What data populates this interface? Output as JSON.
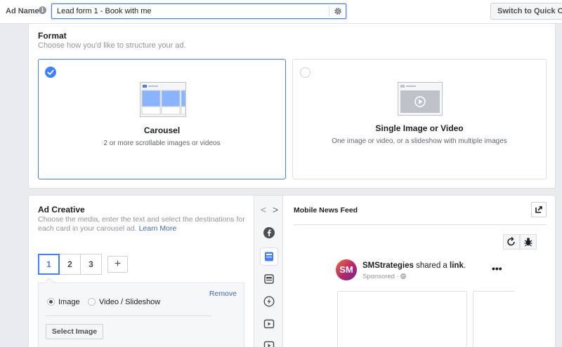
{
  "top_bar": {
    "ad_name_label": "Ad Name",
    "ad_name_value": "Lead form 1 - Book with me",
    "switch_button_label": "Switch to Quick Cre"
  },
  "format": {
    "title": "Format",
    "subtitle": "Choose how you'd like to structure your ad.",
    "options": [
      {
        "title": "Carousel",
        "description": "2 or more scrollable images or videos",
        "selected": true
      },
      {
        "title": "Single Image or Video",
        "description": "One image or video, or a slideshow with multiple images",
        "selected": false
      }
    ]
  },
  "ad_creative": {
    "title": "Ad Creative",
    "description": "Choose the media, enter the text and select the destinations for each card in your carousel ad.",
    "learn_more": "Learn More",
    "card_tabs": [
      "1",
      "2",
      "3"
    ],
    "add_card_label": "+",
    "active_card": "1",
    "remove_label": "Remove",
    "media_options": [
      {
        "label": "Image",
        "selected": true
      },
      {
        "label": "Video / Slideshow",
        "selected": false
      }
    ],
    "select_image_label": "Select Image"
  },
  "placement_rail": {
    "nav_prev": "<",
    "nav_next": ">",
    "icons": [
      "facebook-icon",
      "news-feed-icon",
      "marketplace-icon",
      "instant-articles-icon",
      "video-feed-icon",
      "stories-icon"
    ],
    "active": "news-feed-icon"
  },
  "preview": {
    "title": "Mobile News Feed",
    "page_name": "SMStrategies",
    "shared_text": "shared a",
    "link_text": "link",
    "sponsored": "Sponsored",
    "avatar_text": "SM"
  },
  "colors": {
    "accent": "#4080ff",
    "link": "#4267b2",
    "background": "#e9ebee"
  }
}
